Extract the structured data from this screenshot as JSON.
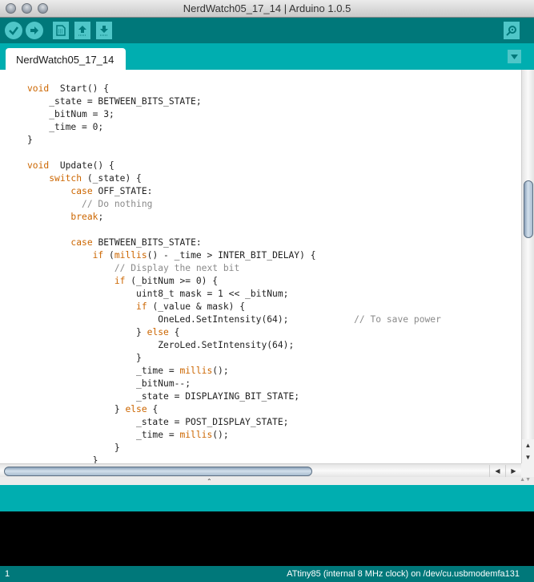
{
  "window": {
    "title": "NerdWatch05_17_14 | Arduino 1.0.5"
  },
  "toolbar": {
    "buttons": [
      {
        "name": "verify",
        "icon": "checkmark-icon"
      },
      {
        "name": "upload",
        "icon": "arrow-right-icon"
      },
      {
        "name": "new",
        "icon": "new-document-icon"
      },
      {
        "name": "open",
        "icon": "open-arrow-up-icon"
      },
      {
        "name": "save",
        "icon": "save-arrow-down-icon"
      },
      {
        "name": "serial-monitor",
        "icon": "magnifier-icon"
      }
    ],
    "colors": {
      "bar": "#00787a",
      "button": "#4fc6c8"
    }
  },
  "tabs": [
    {
      "label": "NerdWatch05_17_14",
      "active": true
    }
  ],
  "editor": {
    "lines": [
      [
        [
          "kw",
          "void"
        ],
        [
          "",
          "  Start() {"
        ]
      ],
      [
        [
          "",
          "    _state = BETWEEN_BITS_STATE;"
        ]
      ],
      [
        [
          "",
          "    _bitNum = 3;"
        ]
      ],
      [
        [
          "",
          "    _time = 0;"
        ]
      ],
      [
        [
          "",
          "}"
        ]
      ],
      [
        [
          "",
          ""
        ]
      ],
      [
        [
          "kw",
          "void"
        ],
        [
          "",
          "  Update() {"
        ]
      ],
      [
        [
          "",
          "    "
        ],
        [
          "kw",
          "switch"
        ],
        [
          "",
          " (_state) {"
        ]
      ],
      [
        [
          "",
          "        "
        ],
        [
          "kw",
          "case"
        ],
        [
          "",
          " OFF_STATE:"
        ]
      ],
      [
        [
          "",
          "          "
        ],
        [
          "cm",
          "// Do nothing"
        ]
      ],
      [
        [
          "",
          "        "
        ],
        [
          "kw",
          "break"
        ],
        [
          "",
          ";"
        ]
      ],
      [
        [
          "",
          ""
        ]
      ],
      [
        [
          "",
          "        "
        ],
        [
          "kw",
          "case"
        ],
        [
          "",
          " BETWEEN_BITS_STATE:"
        ]
      ],
      [
        [
          "",
          "            "
        ],
        [
          "kw",
          "if"
        ],
        [
          "",
          " ("
        ],
        [
          "kw",
          "millis"
        ],
        [
          "",
          "() - _time > INTER_BIT_DELAY) {"
        ]
      ],
      [
        [
          "",
          "                "
        ],
        [
          "cm",
          "// Display the next bit"
        ]
      ],
      [
        [
          "",
          "                "
        ],
        [
          "kw",
          "if"
        ],
        [
          "",
          " (_bitNum >= 0) {"
        ]
      ],
      [
        [
          "",
          "                    uint8_t mask = 1 << _bitNum;"
        ]
      ],
      [
        [
          "",
          "                    "
        ],
        [
          "kw",
          "if"
        ],
        [
          "",
          " (_value & mask) {"
        ]
      ],
      [
        [
          "",
          "                        OneLed.SetIntensity(64);            "
        ],
        [
          "cm",
          "// To save power"
        ]
      ],
      [
        [
          "",
          "                    } "
        ],
        [
          "kw",
          "else"
        ],
        [
          "",
          " {"
        ]
      ],
      [
        [
          "",
          "                        ZeroLed.SetIntensity(64);"
        ]
      ],
      [
        [
          "",
          "                    }"
        ]
      ],
      [
        [
          "",
          "                    _time = "
        ],
        [
          "kw",
          "millis"
        ],
        [
          "",
          "();"
        ]
      ],
      [
        [
          "",
          "                    _bitNum--;"
        ]
      ],
      [
        [
          "",
          "                    _state = DISPLAYING_BIT_STATE;"
        ]
      ],
      [
        [
          "",
          "                } "
        ],
        [
          "kw",
          "else"
        ],
        [
          "",
          " {"
        ]
      ],
      [
        [
          "",
          "                    _state = POST_DISPLAY_STATE;"
        ]
      ],
      [
        [
          "",
          "                    _time = "
        ],
        [
          "kw",
          "millis"
        ],
        [
          "",
          "();"
        ]
      ],
      [
        [
          "",
          "                }"
        ]
      ],
      [
        [
          "",
          "            }"
        ]
      ]
    ],
    "colors": {
      "keyword": "#cc6600",
      "comment": "#8a8a8a",
      "text": "#222222"
    }
  },
  "status_message": "",
  "console": "",
  "statusbar": {
    "line_number": "1",
    "board": "ATtiny85 (internal 8 MHz clock) on /dev/cu.usbmodemfa131"
  }
}
